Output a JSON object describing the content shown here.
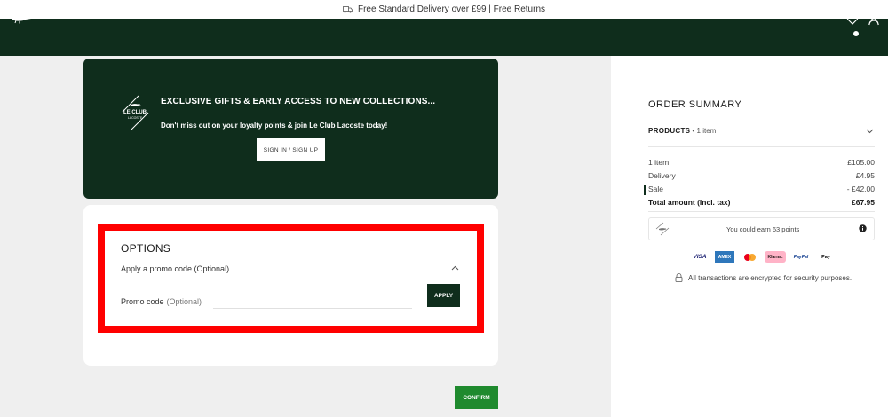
{
  "topbar": {
    "text": "Free Standard Delivery over £99 | Free Returns"
  },
  "header": {
    "logo": "crocodile-logo",
    "icons": [
      "heart-icon",
      "user-icon"
    ]
  },
  "club": {
    "logo_lines": [
      "LE CLUB",
      "LACOSTE"
    ],
    "title": "EXCLUSIVE GIFTS & EARLY ACCESS TO NEW COLLECTIONS...",
    "subtitle": "Don't miss out on your loyalty points & join Le Club Lacoste today!",
    "button": "SIGN IN / SIGN UP"
  },
  "options": {
    "title": "OPTIONS",
    "promo_toggle": "Apply a promo code (Optional)",
    "promo_label": "Promo code",
    "promo_optional": "(Optional)",
    "promo_value": "",
    "apply": "APPLY"
  },
  "confirm": "CONFIRM",
  "summary": {
    "title": "ORDER SUMMARY",
    "products_label": "PRODUCTS",
    "products_count": "• 1 item",
    "rows": [
      {
        "label": "1 item",
        "value": "£105.00"
      },
      {
        "label": "Delivery",
        "value": "£4.95"
      },
      {
        "label": "Sale",
        "value": "- £42.00"
      },
      {
        "label": "Total amount (Incl. tax)",
        "value": "£67.95"
      }
    ],
    "points_text": "You could earn 63 points",
    "payments": [
      "VISA",
      "AMEX",
      "mastercard",
      "Klarna",
      "PayPal",
      "Apple Pay"
    ],
    "payment_labels": {
      "visa": "VISA",
      "amex": "AMEX",
      "klarna": "Klarna.",
      "paypal": "PayPal",
      "apple": " Pay"
    },
    "secure_text": "All transactions are encrypted for security purposes."
  },
  "colors": {
    "brand_green": "#0f2d1c",
    "confirm_green": "#1f8a2e",
    "highlight": "#ff0000"
  }
}
